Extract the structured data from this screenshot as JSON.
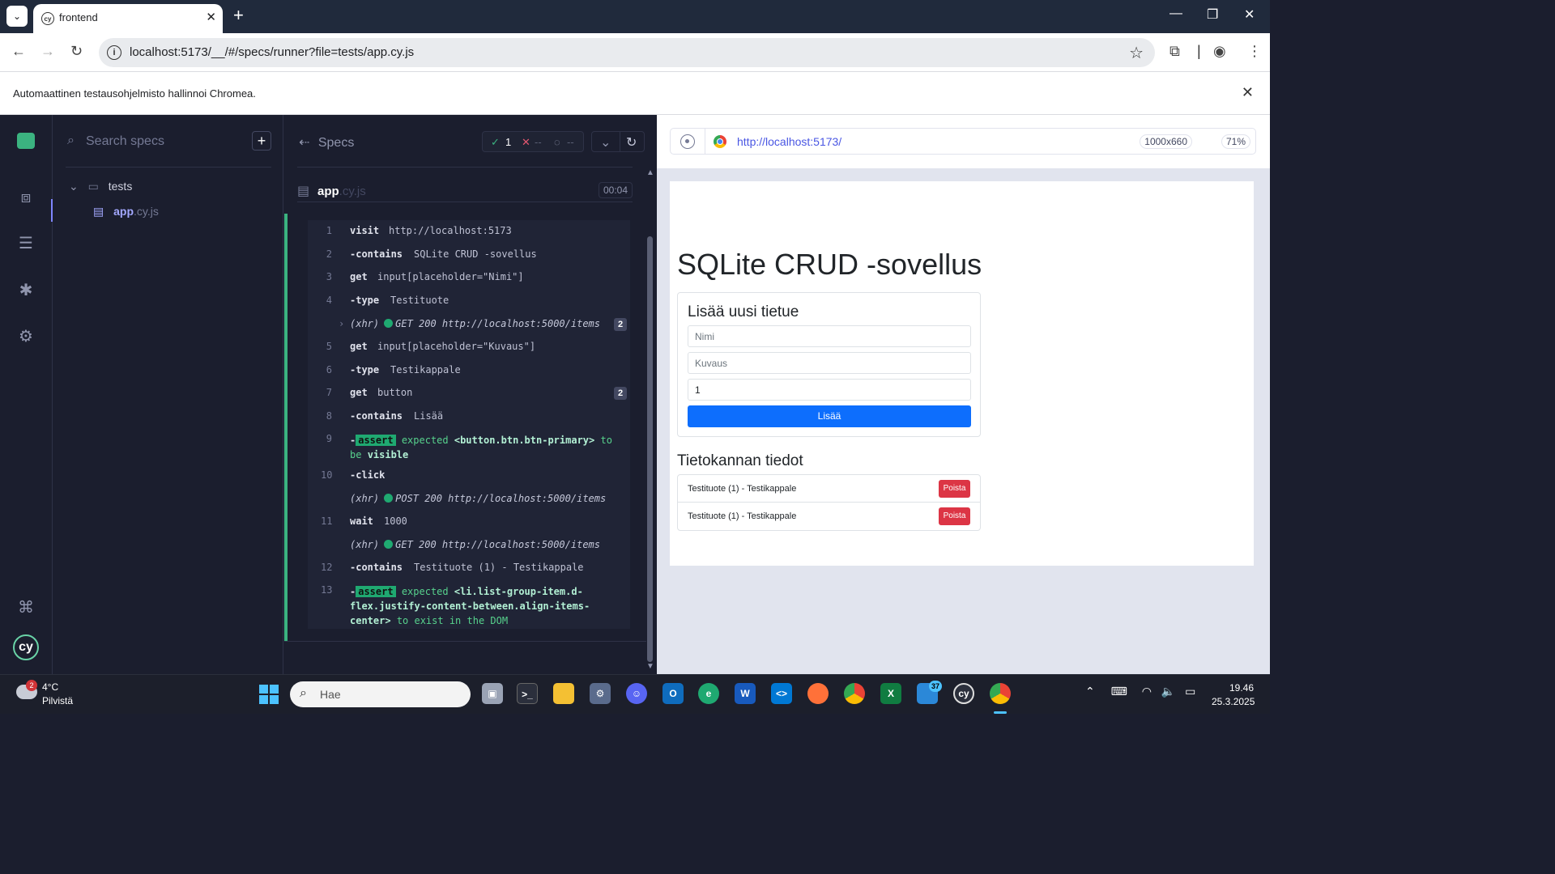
{
  "browser": {
    "tab_title": "frontend",
    "url": "localhost:5173/__/#/specs/runner?file=tests/app.cy.js",
    "infobar_text": "Automaattinen testausohjelmisto hallinnoi Chromea."
  },
  "sidebar": {
    "search_placeholder": "Search specs",
    "folder": "tests",
    "spec_name": "app",
    "spec_ext": ".cy.js"
  },
  "reporter": {
    "specs_label": "Specs",
    "passed": "1",
    "failed": "--",
    "pending": "--",
    "file_name": "app",
    "file_ext": ".cy.js",
    "duration": "00:04"
  },
  "commands": [
    {
      "num": "1",
      "name": "visit",
      "msg": "http://localhost:5173"
    },
    {
      "num": "2",
      "name": "-contains",
      "msg": "SQLite CRUD -sovellus"
    },
    {
      "num": "3",
      "name": "get",
      "msg": "input[placeholder=\"Nimi\"]"
    },
    {
      "num": "4",
      "name": "-type",
      "msg": "Testituote"
    },
    {
      "xhr": "(xhr)",
      "method": "GET 200 http://localhost:5000/items",
      "badge": "2"
    },
    {
      "num": "5",
      "name": "get",
      "msg": "input[placeholder=\"Kuvaus\"]"
    },
    {
      "num": "6",
      "name": "-type",
      "msg": "Testikappale"
    },
    {
      "num": "7",
      "name": "get",
      "msg": "button",
      "badge": "2"
    },
    {
      "num": "8",
      "name": "-contains",
      "msg": "Lisää"
    },
    {
      "num": "9",
      "name": "-",
      "tag": "assert",
      "a1": "expected",
      "a2": "<button.btn.btn-primary>",
      "a3": "to",
      "a4": "be",
      "a5": "visible"
    },
    {
      "num": "10",
      "name": "-click",
      "msg": ""
    },
    {
      "xhr": "(xhr)",
      "method": "POST 200 http://localhost:5000/items"
    },
    {
      "num": "11",
      "name": "wait",
      "msg": "1000"
    },
    {
      "xhr": "(xhr)",
      "method": "GET 200 http://localhost:5000/items"
    },
    {
      "num": "12",
      "name": "-contains",
      "msg": "Testituote (1) - Testikappale"
    },
    {
      "num": "13",
      "name": "-",
      "tag": "assert",
      "a1": "expected",
      "a2": "<li.list-group-item.d-",
      "a2b": "flex.justify-content-between.align-items-",
      "a2c": "center>",
      "a3": "to exist in the DOM"
    }
  ],
  "aut": {
    "url": "http://localhost:5173/",
    "viewport": "1000x660",
    "zoom": "71%",
    "app_title": "SQLite CRUD -sovellus",
    "add_title": "Lisää uusi tietue",
    "name_placeholder": "Nimi",
    "desc_placeholder": "Kuvaus",
    "qty_value": "1",
    "add_button": "Lisää",
    "db_title": "Tietokannan tiedot",
    "items": [
      {
        "text": "Testituote (1) - Testikappale",
        "delete": "Poista"
      },
      {
        "text": "Testituote (1) - Testikappale",
        "delete": "Poista"
      }
    ]
  },
  "taskbar": {
    "weather_temp": "4°C",
    "weather_desc": "Pilvistä",
    "weather_badge": "2",
    "search_placeholder": "Hae",
    "cypress_badge": "37",
    "time": "19.46",
    "date": "25.3.2025"
  },
  "colors": {
    "pass": "#1fa971",
    "primary": "#0d6efd",
    "danger": "#dc3545",
    "cy_bg": "#1b1e2e"
  }
}
